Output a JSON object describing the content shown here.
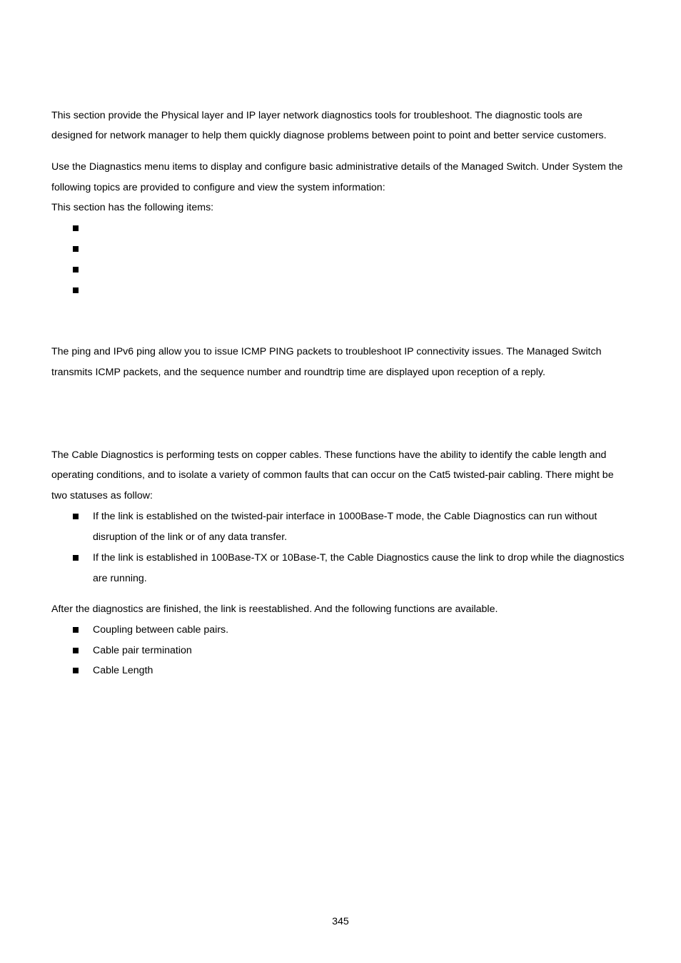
{
  "intro": {
    "paragraph1": [
      "This section provide the Physical layer and IP layer network diagnostics tools for troubleshoot. The diagnostic tools are",
      "designed for network manager to help them quickly diagnose problems between point to point and better service customers."
    ],
    "paragraph2": [
      "Use the Diagnastics menu items to display and configure basic administrative details of the Managed Switch. Under System the",
      "following topics are provided to configure and view the system information:"
    ],
    "items_intro": "This section has the following items:",
    "items": [
      "",
      "",
      "",
      ""
    ]
  },
  "ping": {
    "paragraph": [
      "The ping and IPv6 ping allow you to issue ICMP PING packets to troubleshoot IP connectivity issues. The Managed Switch",
      "transmits ICMP packets, and the sequence number and roundtrip time are displayed upon reception of a reply."
    ]
  },
  "cable_diagnostics": {
    "paragraph": [
      "The Cable Diagnostics is performing tests on copper cables. These functions have the ability to identify the cable length and",
      "operating conditions, and to isolate a variety of common faults that can occur on the Cat5 twisted-pair cabling. There might be",
      "two statuses as follow:"
    ],
    "statuses": [
      {
        "lines": [
          "If the link is established on the twisted-pair interface in 1000Base-T mode, the Cable Diagnostics can run without",
          "disruption of the link or of any data transfer."
        ]
      },
      {
        "lines": [
          "If the link is established in 100Base-TX or 10Base-T, the Cable Diagnostics cause the link to drop while the diagnostics",
          "are running."
        ]
      }
    ],
    "after_text": "After the diagnostics are finished, the link is reestablished. And the following functions are available.",
    "functions": [
      "Coupling between cable pairs.",
      "Cable pair termination",
      "Cable Length"
    ]
  },
  "footer": {
    "page_number": "345"
  }
}
